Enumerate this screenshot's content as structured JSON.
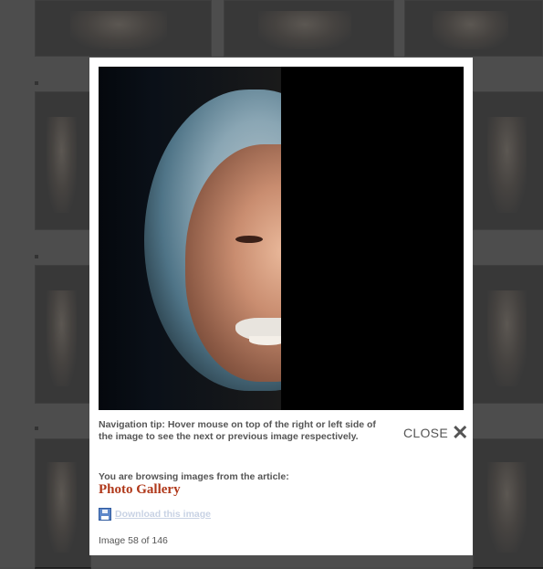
{
  "lightbox": {
    "navigation_tip": "Navigation tip: Hover mouse on top of the right or left side of the image to see the next or previous image respectively.",
    "close_label": "CLOSE",
    "close_icon": "x-icon",
    "browsing_label": "You are browsing images from the article:",
    "article_link": "Photo Gallery",
    "download_label": "Download this image",
    "download_icon": "floppy-disk-icon",
    "image_counter": "Image 58 of 146",
    "photo_description_colors": {
      "link": "#b0391b",
      "download": "#c8d2e4",
      "text": "#555555"
    }
  }
}
